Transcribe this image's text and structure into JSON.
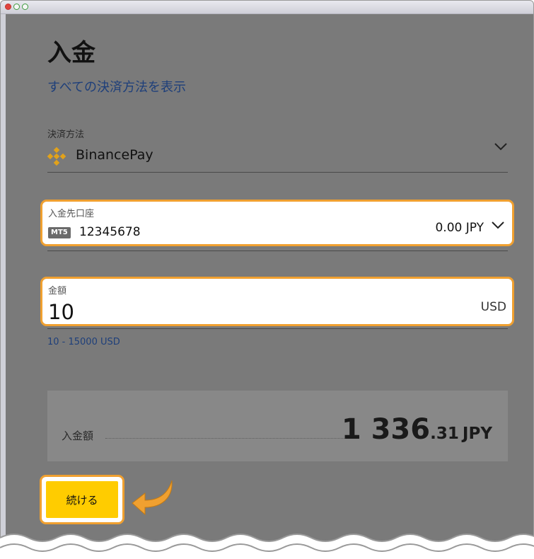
{
  "page": {
    "title": "入金",
    "all_methods_link": "すべての決済方法を表示"
  },
  "payment_method": {
    "label": "決済方法",
    "value": "BinancePay",
    "icon": "binance-icon"
  },
  "account": {
    "label": "入金先口座",
    "badge": "MT5",
    "number": "12345678",
    "balance": "0.00 JPY"
  },
  "amount": {
    "label": "金額",
    "value": "10",
    "currency": "USD",
    "range_hint": "10 - 15000 USD"
  },
  "summary": {
    "label": "入金額",
    "amount_int": "1 336",
    "amount_dec": ".31",
    "currency": "JPY"
  },
  "actions": {
    "continue_label": "続ける"
  },
  "colors": {
    "highlight": "#f0a030",
    "primary_button": "#ffcc00",
    "link": "#1e3f7a",
    "overlay": "#7a7a7a"
  }
}
